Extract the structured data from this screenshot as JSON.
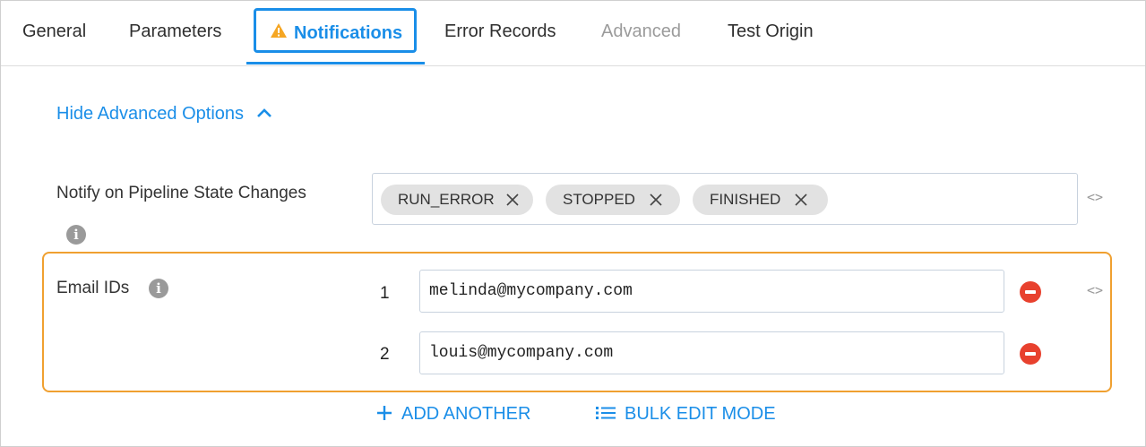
{
  "tabs": [
    {
      "label": "General",
      "state": "normal"
    },
    {
      "label": "Parameters",
      "state": "normal"
    },
    {
      "label": "Notifications",
      "state": "active",
      "icon": "warning-icon"
    },
    {
      "label": "Error Records",
      "state": "normal"
    },
    {
      "label": "Advanced",
      "state": "disabled"
    },
    {
      "label": "Test Origin",
      "state": "normal"
    }
  ],
  "advanced_toggle": {
    "label": "Hide Advanced Options",
    "icon": "chevron-up-icon"
  },
  "notify_field": {
    "label": "Notify on Pipeline State Changes",
    "chips": [
      {
        "label": "RUN_ERROR"
      },
      {
        "label": "STOPPED"
      },
      {
        "label": "FINISHED"
      }
    ],
    "code_toggle": "<>"
  },
  "email_field": {
    "label": "Email IDs",
    "rows": [
      {
        "index": "1",
        "value": "melinda@mycompany.com"
      },
      {
        "index": "2",
        "value": "louis@mycompany.com"
      }
    ],
    "code_toggle": "<>"
  },
  "actions": {
    "add_another": "ADD ANOTHER",
    "bulk_edit": "BULK EDIT MODE"
  },
  "colors": {
    "accent": "#1a8ee8",
    "warning": "#f5a623",
    "highlight_border": "#f0a030",
    "remove": "#e8412e",
    "chip_bg": "#e2e2e2"
  }
}
